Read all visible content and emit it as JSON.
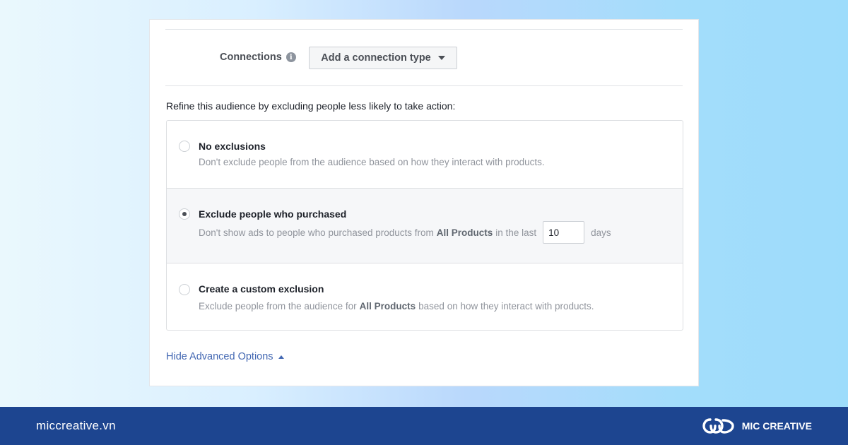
{
  "connections": {
    "label": "Connections",
    "info_icon": "info-icon",
    "dropdown_label": "Add a connection type"
  },
  "refine_text": "Refine this audience by excluding people less likely to take action:",
  "options": [
    {
      "title": "No exclusions",
      "description": "Don't exclude people from the audience based on how they interact with products.",
      "selected": false
    },
    {
      "title": "Exclude people who purchased",
      "desc_before": "Don't show ads to people who purchased products from",
      "desc_bold": "All Products",
      "desc_middle": "in the last",
      "days_value": "10",
      "desc_after": "days",
      "selected": true
    },
    {
      "title": "Create a custom exclusion",
      "desc_before": "Exclude people from the audience for",
      "desc_bold": "All Products",
      "desc_after": "based on how they interact with products.",
      "selected": false
    }
  ],
  "hide_advanced": "Hide Advanced Options",
  "footer": {
    "site": "miccreative.vn",
    "brand": "MIC CREATIVE"
  },
  "colors": {
    "footer_bg": "#1d4590",
    "link": "#4267b2"
  }
}
